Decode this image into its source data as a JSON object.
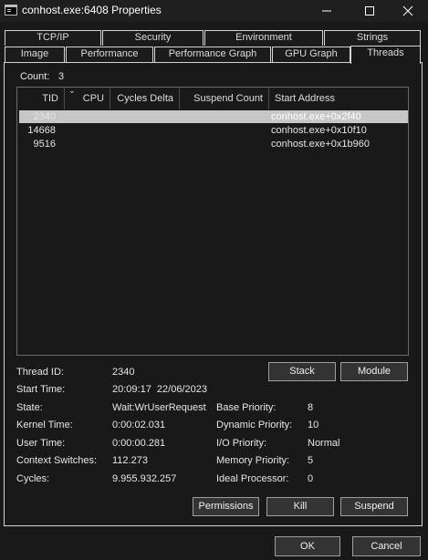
{
  "window": {
    "title": "conhost.exe:6408 Properties"
  },
  "tabs_row1": [
    {
      "label": "TCP/IP"
    },
    {
      "label": "Security"
    },
    {
      "label": "Environment"
    },
    {
      "label": "Strings"
    }
  ],
  "tabs_row2": [
    {
      "label": "Image"
    },
    {
      "label": "Performance"
    },
    {
      "label": "Performance Graph"
    },
    {
      "label": "GPU Graph"
    },
    {
      "label": "Threads"
    }
  ],
  "threads": {
    "count_label": "Count:",
    "count_value": "3",
    "columns": [
      "TID",
      "CPU",
      "Cycles Delta",
      "Suspend Count",
      "Start Address"
    ],
    "rows": [
      {
        "tid": "2340",
        "cpu": "",
        "cycles_delta": "",
        "suspend_count": "",
        "start_address": "conhost.exe+0x2f40",
        "selected": true
      },
      {
        "tid": "14668",
        "cpu": "",
        "cycles_delta": "",
        "suspend_count": "",
        "start_address": "conhost.exe+0x10f10",
        "selected": false
      },
      {
        "tid": "9516",
        "cpu": "",
        "cycles_delta": "",
        "suspend_count": "",
        "start_address": "conhost.exe+0x1b960",
        "selected": false
      }
    ]
  },
  "details": {
    "thread_id": {
      "label": "Thread ID:",
      "value": "2340"
    },
    "start_time": {
      "label": "Start Time:",
      "value": "20:09:17  22/06/2023"
    },
    "state": {
      "label": "State:",
      "value": "Wait:WrUserRequest"
    },
    "kernel_time": {
      "label": "Kernel Time:",
      "value": "0:00:02.031"
    },
    "user_time": {
      "label": "User Time:",
      "value": "0:00:00.281"
    },
    "context_switches": {
      "label": "Context Switches:",
      "value": "112.273"
    },
    "cycles": {
      "label": "Cycles:",
      "value": "9.955.932.257"
    },
    "base_priority": {
      "label": "Base Priority:",
      "value": "8"
    },
    "dynamic_priority": {
      "label": "Dynamic Priority:",
      "value": "10"
    },
    "io_priority": {
      "label": "I/O Priority:",
      "value": "Normal"
    },
    "memory_priority": {
      "label": "Memory Priority:",
      "value": "5"
    },
    "ideal_processor": {
      "label": "Ideal Processor:",
      "value": "0"
    }
  },
  "buttons": {
    "stack": "Stack",
    "module": "Module",
    "permissions": "Permissions",
    "kill": "Kill",
    "suspend": "Suspend",
    "ok": "OK",
    "cancel": "Cancel"
  },
  "colors": {
    "background": "#191919",
    "selection": "#c7c7c7",
    "border": "#d4d4d4"
  }
}
